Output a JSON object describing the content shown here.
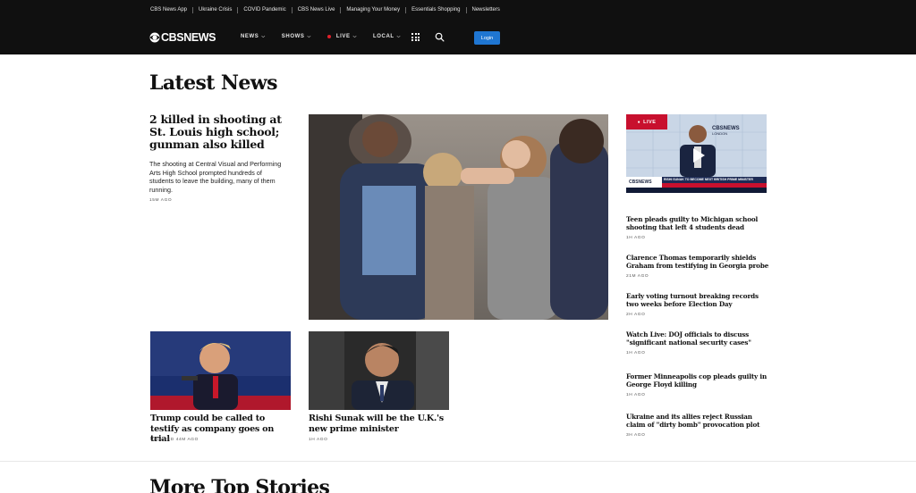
{
  "utility_nav": [
    "CBS News App",
    "Ukraine Crisis",
    "COVID Pandemic",
    "CBS News Live",
    "Managing Your Money",
    "Essentials Shopping",
    "Newsletters"
  ],
  "brand": {
    "logo_text": "CBSNEWS"
  },
  "main_nav": {
    "items": [
      {
        "label": "NEWS",
        "has_caret": true,
        "live": false
      },
      {
        "label": "SHOWS",
        "has_caret": true,
        "live": false
      },
      {
        "label": "LIVE",
        "has_caret": true,
        "live": true
      },
      {
        "label": "LOCAL",
        "has_caret": true,
        "live": false
      }
    ],
    "login_label": "Login",
    "icons": [
      "apps-grid-icon",
      "search-icon"
    ],
    "accent_color": "#1f76d2",
    "live_color": "#e0202a"
  },
  "page": {
    "title": "Latest News",
    "lead": {
      "headline": "2 killed in shooting at St. Louis high school; gunman also killed",
      "description": "The shooting at Central Visual and Performing Arts High School prompted hundreds of students to leave the building, many of them running.",
      "time": "15M AGO"
    },
    "cards": [
      {
        "headline": "Trump could be called to testify as company goes on trial",
        "time": "UPDATED 44M AGO"
      },
      {
        "headline": "Rishi Sunak will be the U.K.'s new prime minister",
        "time": "1H AGO"
      }
    ],
    "live_video": {
      "badge": "LIVE",
      "brand_text": "CBSNEWS",
      "location_text": "LONDON",
      "ticker_text": "RISHI SUNAK TO BECOME NEXT BRITISH PRIME MINISTER"
    },
    "rail": [
      {
        "headline": "Teen pleads guilty to Michigan school shooting that left 4 students dead",
        "time": "1H AGO"
      },
      {
        "headline": "Clarence Thomas temporarily shields Graham from testifying in Georgia probe",
        "time": "21M AGO"
      },
      {
        "headline": "Early voting turnout breaking records two weeks before Election Day",
        "time": "2H AGO"
      },
      {
        "headline": "Watch Live: DOJ officials to discuss \"significant national security cases\"",
        "time": "1H AGO"
      },
      {
        "headline": "Former Minneapolis cop pleads guilty in George Floyd killing",
        "time": "1H AGO"
      },
      {
        "headline": "Ukraine and its allies reject Russian claim of \"dirty bomb\" provocation plot",
        "time": "3H AGO"
      }
    ],
    "next_section_title": "More Top Stories"
  }
}
